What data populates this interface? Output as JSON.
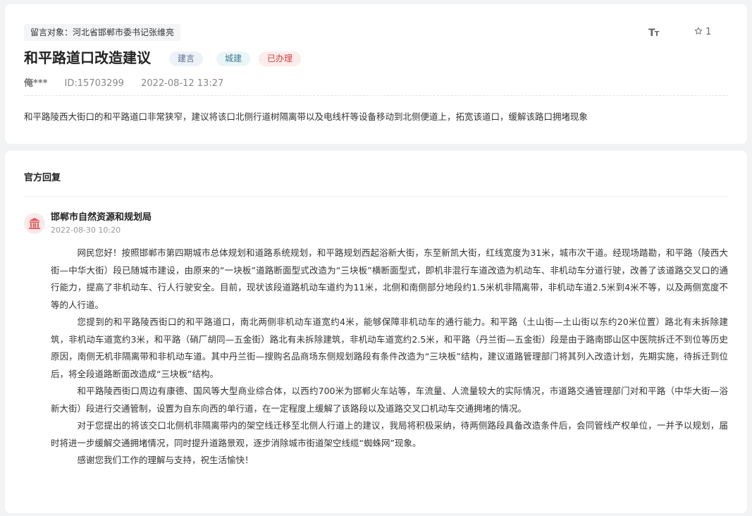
{
  "message": {
    "target_label": "留言对象：河北省邯郸市委书记张维亮",
    "title": "和平路道口改造建议",
    "tags": [
      "建言",
      "城建",
      "已办理"
    ],
    "author": "俺***",
    "id_text": "ID:15703299",
    "datetime": "2022-08-12 13:27",
    "content": "和平路陵西大街口的和平路道口非常狭窄，建议将该口北侧行道树隔离带以及电线杆等设备移动到北侧便道上，拓宽该道口，缓解该路口拥堵现象"
  },
  "toolbar": {
    "font_icon_text": "TT",
    "star_count": "1"
  },
  "reply": {
    "heading": "官方回复",
    "org_name": "邯郸市自然资源和规划局",
    "org_date": "2022-08-30 10:20",
    "paragraphs": [
      "网民您好！按照邯郸市第四期城市总体规划和道路系统规划，和平路规划西起浴新大街，东至新凯大街，红线宽度为31米，城市次干道。经现场踏勘，和平路（陵西大街—中华大街）段已随城市建设，由原来的“一块板”道路断面型式改造为“三块板”横断面型式，即机非混行车道改造为机动车、非机动车分道行驶，改善了该道路交叉口的通行能力，提高了非机动车、行人行驶安全。目前，现状该段道路机动车道约为11米，北侧和南侧部分地段约1.5米机非隔离带，非机动车道2.5米到4米不等，以及两侧宽度不等的人行道。",
      "您提到的和平路陵西街口的和平路道口，南北两侧非机动车道宽约4米，能够保障非机动车的通行能力。和平路（土山街—土山街以东约20米位置）路北有未拆除建筑，非机动车道宽约3米，和平路（硝厂胡同—五金街）路北有未拆除建筑，非机动车道宽约2.5米，和平路（丹兰街—五金街）段是由于路南邯山区中医院拆迁不到位等历史原因，南侧无机非隔离带和非机动车道。其中丹兰街—搜购名品商场东侧规划路段有条件改造为“三块板”结构，建议道路管理部门将其列入改造计划，先期实施，待拆迁到位后，将全段道路断面改造成“三块板”结构。",
      "和平路陵西街口周边有康德、国风等大型商业综合体，以西约700米为邯郸火车站等，车流量、人流量较大的实际情况，市道路交通管理部门对和平路（中华大街—浴新大街）段进行交通管制，设置为自东向西的单行道，在一定程度上缓解了该路段以及道路交叉口机动车交通拥堵的情况。",
      "对于您提出的将该交口北侧机非隔离带内的架空线迁移至北侧人行道上的建议，我局将积极采纳，待两侧路段具备改造条件后，会同管线产权单位，一并予以规划，届时将进一步缓解交通拥堵情况，同时提升道路景观，逐步消除城市街道架空线缆“蜘蛛网”现象。",
      "感谢您我们工作的理解与支持，祝生活愉快！"
    ]
  },
  "icons": {
    "font_size": "font-size-icon",
    "star": "star-icon",
    "org": "government-building-icon"
  },
  "colors": {
    "tag_done_text": "#d43c3c",
    "tag_done_bg": "#fdecec",
    "icon_red": "#e05a5a"
  }
}
